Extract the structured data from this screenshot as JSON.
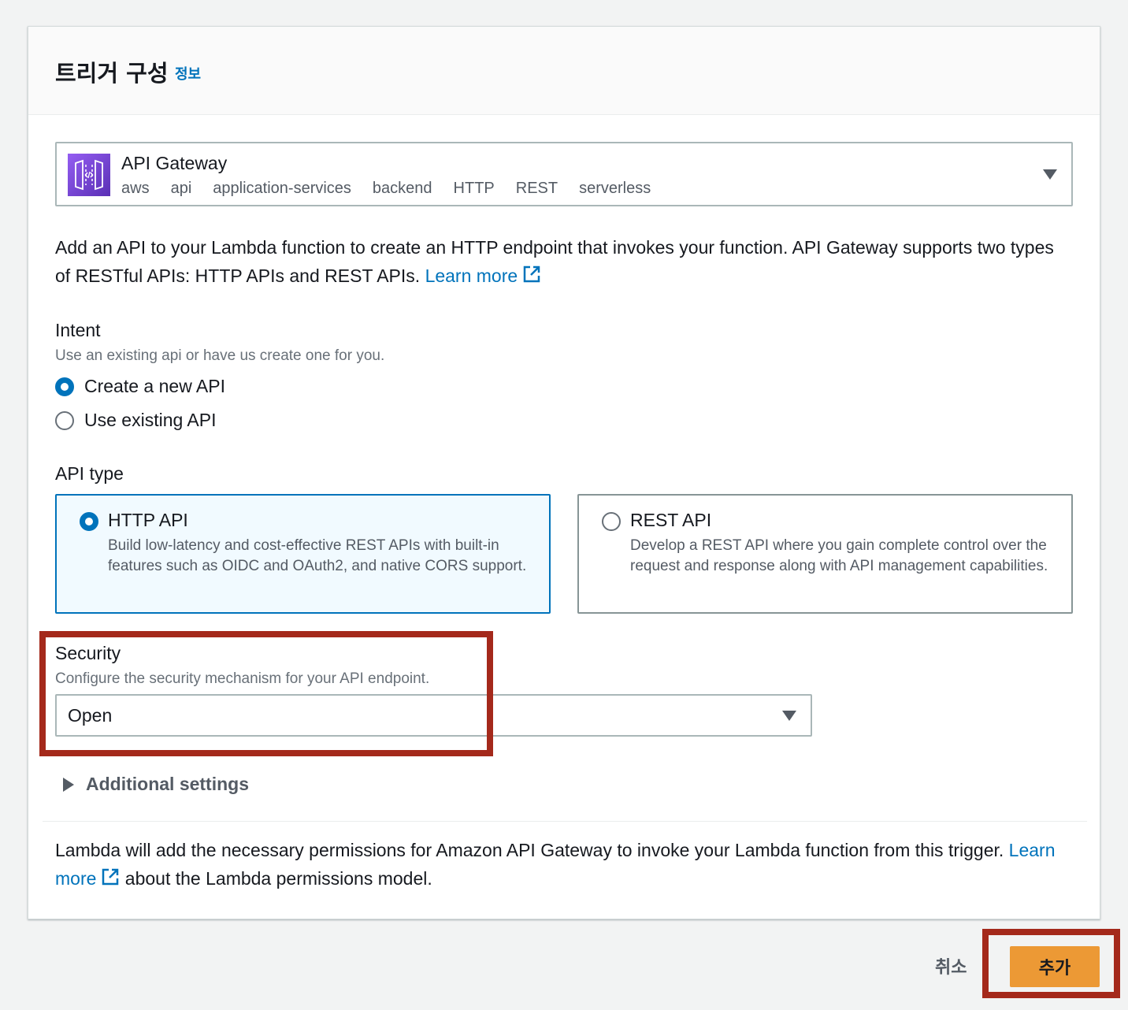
{
  "header": {
    "title": "트리거 구성",
    "info_link": "정보"
  },
  "trigger": {
    "service_name": "API Gateway",
    "tags": [
      "aws",
      "api",
      "application-services",
      "backend",
      "HTTP",
      "REST",
      "serverless"
    ]
  },
  "description": {
    "text": "Add an API to your Lambda function to create an HTTP endpoint that invokes your function. API Gateway supports two types of RESTful APIs: HTTP APIs and REST APIs.",
    "learn_more": "Learn more"
  },
  "intent": {
    "label": "Intent",
    "description": "Use an existing api or have us create one for you.",
    "options": [
      {
        "label": "Create a new API",
        "selected": true
      },
      {
        "label": "Use existing API",
        "selected": false
      }
    ]
  },
  "api_type": {
    "label": "API type",
    "options": [
      {
        "title": "HTTP API",
        "description": "Build low-latency and cost-effective REST APIs with built-in features such as OIDC and OAuth2, and native CORS support.",
        "selected": true
      },
      {
        "title": "REST API",
        "description": "Develop a REST API where you gain complete control over the request and response along with API management capabilities.",
        "selected": false
      }
    ]
  },
  "security": {
    "label": "Security",
    "description": "Configure the security mechanism for your API endpoint.",
    "value": "Open"
  },
  "additional_settings": {
    "label": "Additional settings"
  },
  "permissions": {
    "text": "Lambda will add the necessary permissions for Amazon API Gateway to invoke your Lambda function from this trigger.",
    "learn_more": "Learn more",
    "suffix": "about the Lambda permissions model."
  },
  "footer": {
    "cancel_label": "취소",
    "add_label": "추가"
  },
  "colors": {
    "link": "#0073bb",
    "primary_button": "#ec9935",
    "highlight": "#a4291b",
    "selected_tile_bg": "#f1faff"
  },
  "icons": {
    "service": "api-gateway-icon",
    "external": "external-link-icon",
    "dropdown": "caret-down-icon",
    "expander": "caret-right-icon"
  }
}
